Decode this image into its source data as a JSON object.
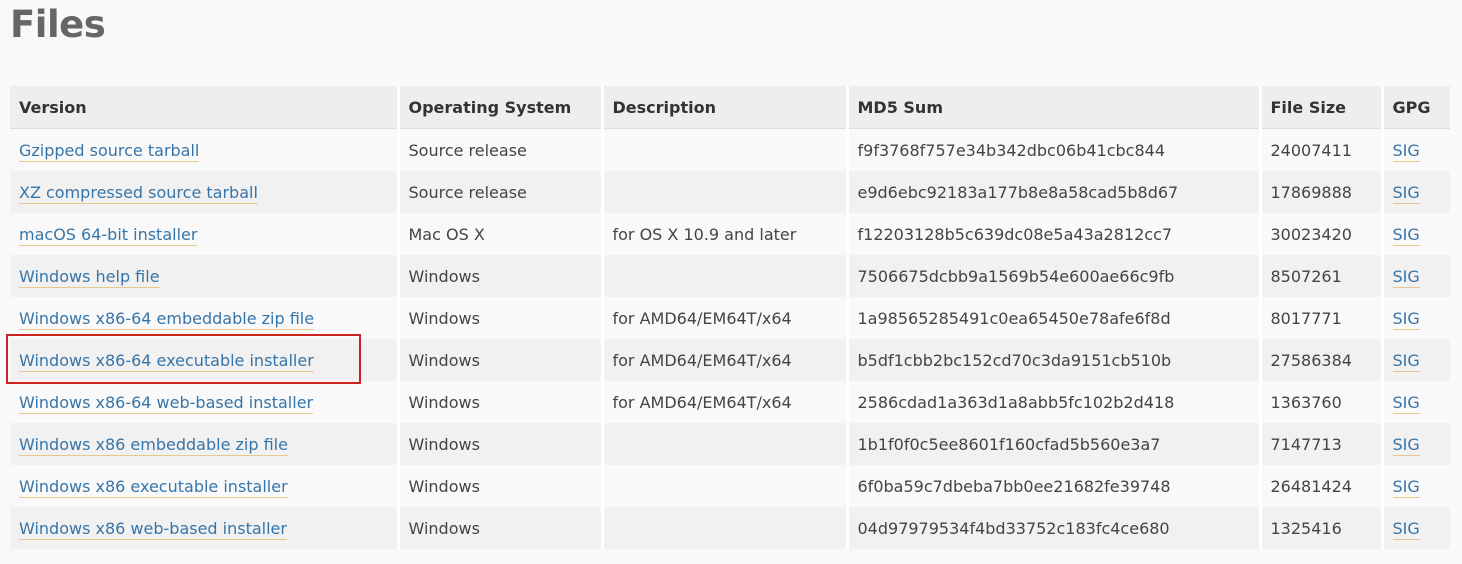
{
  "heading": "Files",
  "columns": {
    "version": "Version",
    "os": "Operating System",
    "description": "Description",
    "md5": "MD5 Sum",
    "size": "File Size",
    "gpg": "GPG"
  },
  "rows": [
    {
      "version": "Gzipped source tarball",
      "os": "Source release",
      "description": "",
      "md5": "f9f3768f757e34b342dbc06b41cbc844",
      "size": "24007411",
      "gpg": "SIG"
    },
    {
      "version": "XZ compressed source tarball",
      "os": "Source release",
      "description": "",
      "md5": "e9d6ebc92183a177b8e8a58cad5b8d67",
      "size": "17869888",
      "gpg": "SIG"
    },
    {
      "version": "macOS 64-bit installer",
      "os": "Mac OS X",
      "description": "for OS X 10.9 and later",
      "md5": "f12203128b5c639dc08e5a43a2812cc7",
      "size": "30023420",
      "gpg": "SIG"
    },
    {
      "version": "Windows help file",
      "os": "Windows",
      "description": "",
      "md5": "7506675dcbb9a1569b54e600ae66c9fb",
      "size": "8507261",
      "gpg": "SIG"
    },
    {
      "version": "Windows x86-64 embeddable zip file",
      "os": "Windows",
      "description": "for AMD64/EM64T/x64",
      "md5": "1a98565285491c0ea65450e78afe6f8d",
      "size": "8017771",
      "gpg": "SIG"
    },
    {
      "version": "Windows x86-64 executable installer",
      "os": "Windows",
      "description": "for AMD64/EM64T/x64",
      "md5": "b5df1cbb2bc152cd70c3da9151cb510b",
      "size": "27586384",
      "gpg": "SIG"
    },
    {
      "version": "Windows x86-64 web-based installer",
      "os": "Windows",
      "description": "for AMD64/EM64T/x64",
      "md5": "2586cdad1a363d1a8abb5fc102b2d418",
      "size": "1363760",
      "gpg": "SIG"
    },
    {
      "version": "Windows x86 embeddable zip file",
      "os": "Windows",
      "description": "",
      "md5": "1b1f0f0c5ee8601f160cfad5b560e3a7",
      "size": "7147713",
      "gpg": "SIG"
    },
    {
      "version": "Windows x86 executable installer",
      "os": "Windows",
      "description": "",
      "md5": "6f0ba59c7dbeba7bb0ee21682fe39748",
      "size": "26481424",
      "gpg": "SIG"
    },
    {
      "version": "Windows x86 web-based installer",
      "os": "Windows",
      "description": "",
      "md5": "04d97979534f4bd33752c183fc4ce680",
      "size": "1325416",
      "gpg": "SIG"
    }
  ],
  "colors": {
    "link": "#3775a9",
    "link_underline": "#e4c98a",
    "highlight": "#cc2222"
  }
}
